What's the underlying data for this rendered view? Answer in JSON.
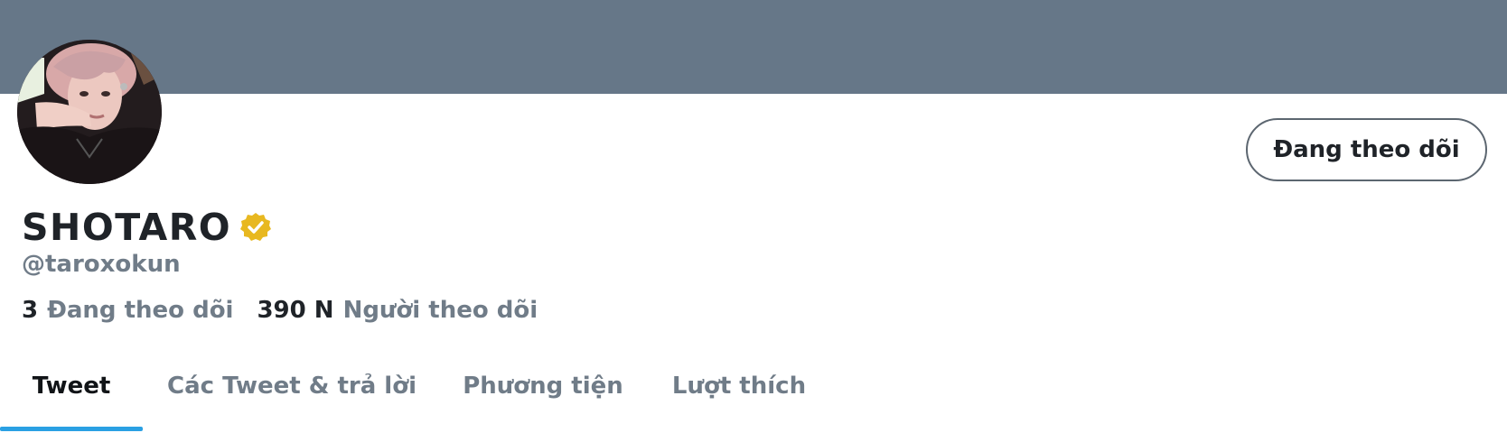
{
  "colors": {
    "banner": "#667788",
    "accent_underline": "#2aa0e3",
    "verified_badge": "#e8b820",
    "text_primary": "#1f2328",
    "text_secondary": "#707c88"
  },
  "profile": {
    "display_name": "SHOTARO",
    "handle": "@taroxokun",
    "verified": true,
    "verified_icon": "verified-badge-icon",
    "avatar_icon": "avatar-photo"
  },
  "actions": {
    "follow_label": "Đang theo dõi"
  },
  "stats": {
    "following_value": "3",
    "following_label": "Đang theo dõi",
    "followers_value": "390 N",
    "followers_label": "Người theo dõi"
  },
  "tabs": [
    {
      "label": "Tweet",
      "active": true
    },
    {
      "label": "Các Tweet & trả lời",
      "active": false
    },
    {
      "label": "Phương tiện",
      "active": false
    },
    {
      "label": "Lượt thích",
      "active": false
    }
  ]
}
